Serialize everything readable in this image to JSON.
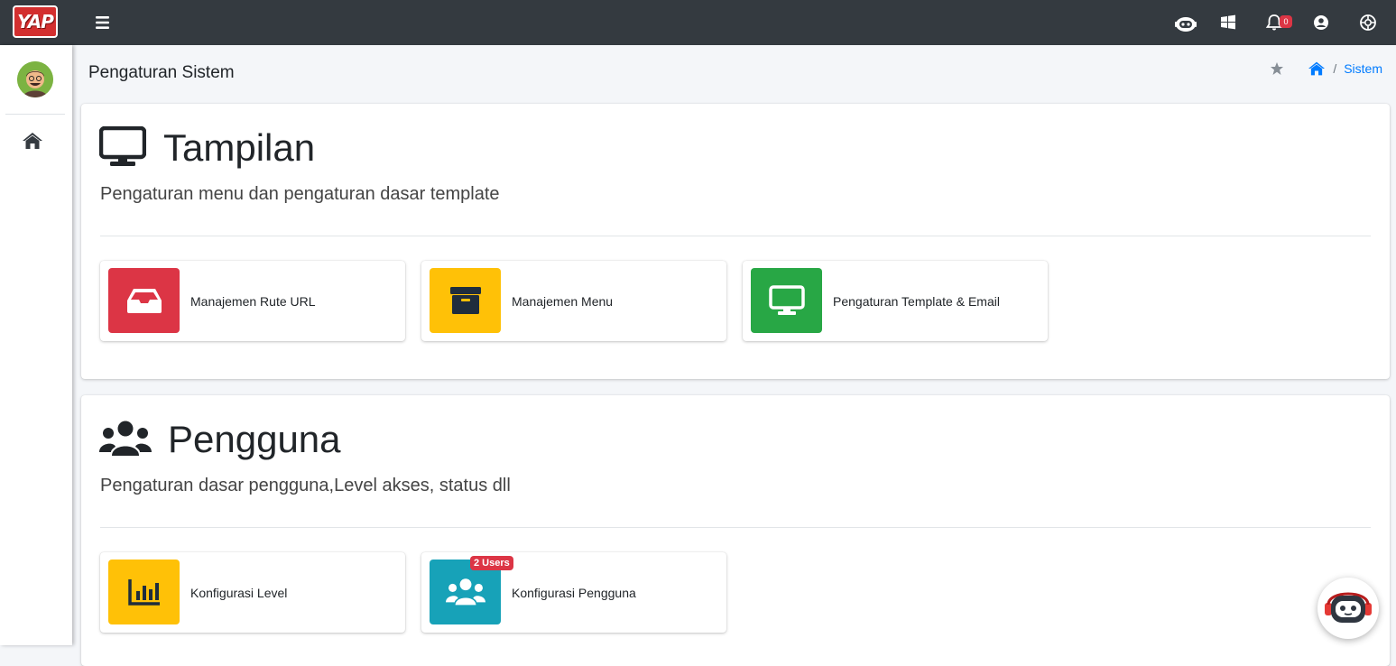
{
  "brand": {
    "logo_text": "YAP"
  },
  "topbar": {
    "icons": [
      "menu-icon",
      "support-robot-icon",
      "windows-icon",
      "bell-icon",
      "user-circle-icon",
      "settings-icon"
    ],
    "notification_count": "0"
  },
  "header": {
    "page_title": "Pengaturan Sistem",
    "breadcrumb": {
      "separator": "/",
      "current": "Sistem"
    }
  },
  "sections": [
    {
      "title": "Tampilan",
      "subtitle": "Pengaturan menu dan pengaturan dasar template",
      "items": [
        {
          "label": "Manajemen Rute URL",
          "icon": "inbox-icon",
          "color": "#dc3545"
        },
        {
          "label": "Manajemen Menu",
          "icon": "archive-icon",
          "color": "#ffc107"
        },
        {
          "label": "Pengaturan Template & Email",
          "icon": "desktop-icon",
          "color": "#28a745"
        }
      ]
    },
    {
      "title": "Pengguna",
      "subtitle": "Pengaturan dasar pengguna,Level akses, status dll",
      "items": [
        {
          "label": "Konfigurasi Level",
          "icon": "chart-bar-icon",
          "color": "#ffc107"
        },
        {
          "label": "Konfigurasi Pengguna",
          "icon": "users-icon",
          "color": "#17a2b8",
          "badge": "2 Users"
        }
      ]
    }
  ],
  "colors": {
    "navbar": "#343a40",
    "link": "#007bff",
    "danger": "#dc3545",
    "warning": "#ffc107",
    "success": "#28a745",
    "info": "#17a2b8"
  }
}
